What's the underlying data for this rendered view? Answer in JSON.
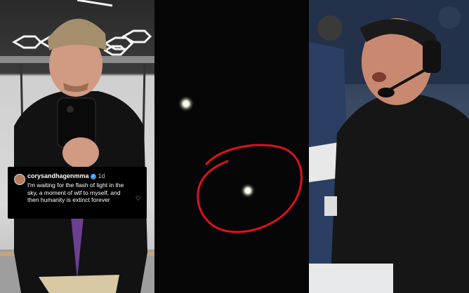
{
  "instagram_comment": {
    "username": "corysandhagenmma",
    "time": "1d",
    "text": "I'm waiting for the flash of light in the sky, a moment of wtf to myself, and then humanity is extinct forever",
    "icons": {
      "verified": "verified-badge-icon",
      "like": "heart-icon"
    }
  },
  "colors": {
    "annotation_circle": "#e0101c",
    "verified_badge": "#3897f0"
  }
}
